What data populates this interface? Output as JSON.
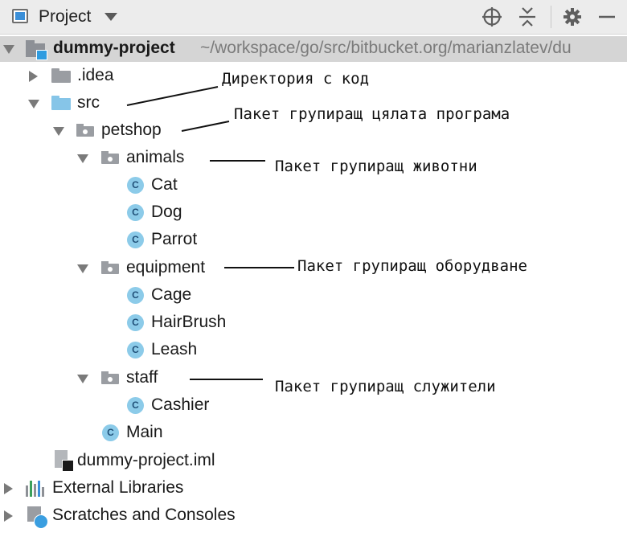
{
  "toolbar": {
    "title": "Project",
    "icons": [
      "project-view-icon",
      "dropdown-arrow-icon",
      "locate-icon",
      "collapse-all-icon",
      "gear-icon",
      "minimize-icon"
    ]
  },
  "tree": {
    "root": {
      "name": "dummy-project",
      "path": "~/workspace/go/src/bitbucket.org/marianzlatev/du"
    },
    "idea": ".idea",
    "src": "src",
    "petshop": "petshop",
    "animals": {
      "name": "animals",
      "classes": [
        "Cat",
        "Dog",
        "Parrot"
      ]
    },
    "equipment": {
      "name": "equipment",
      "classes": [
        "Cage",
        "HairBrush",
        "Leash"
      ]
    },
    "staff": {
      "name": "staff",
      "classes": [
        "Cashier"
      ]
    },
    "main": "Main",
    "iml": "dummy-project.iml",
    "external_libraries": "External Libraries",
    "scratches": "Scratches and Consoles",
    "class_badge": "C"
  },
  "annotations": {
    "src": "Директория с код",
    "petshop": "Пакет групиращ цялата програма",
    "animals": "Пакет групиращ животни",
    "equipment": "Пакет групиращ оборудване",
    "staff": "Пакет групиращ служители"
  },
  "colors": {
    "toolbar_bg": "#ececec",
    "selected_row": "#d5d5d5",
    "source_folder": "#86c5e8",
    "class_icon": "#8ccbe9",
    "project_badge": "#2f9ce0"
  }
}
